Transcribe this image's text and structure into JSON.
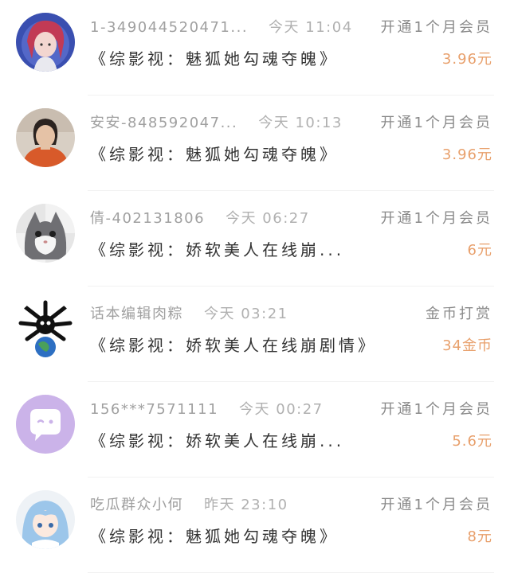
{
  "colors": {
    "amount": "#e8a06c",
    "title": "#333333",
    "meta": "#a0a0a0",
    "divider": "#f1f1f1"
  },
  "records": [
    {
      "name": "1-3490445204​71...",
      "time": "今天 11:04",
      "type": "开通1个月会员",
      "title": "《综影视：魅狐她勾魂夺魄》",
      "amount": "3.96元",
      "avatar": "anime-girl-avatar"
    },
    {
      "name": "安安-848592047...",
      "time": "今天 10:13",
      "type": "开通1个月会员",
      "title": "《综影视：魅狐她勾魂夺魄》",
      "amount": "3.96元",
      "avatar": "woman-photo-avatar"
    },
    {
      "name": "倩-402131806",
      "time": "今天 06:27",
      "type": "开通1个月会员",
      "title": "《综影视：娇软美人在线崩...",
      "amount": "6元",
      "avatar": "cat-avatar"
    },
    {
      "name": "话本编辑肉粽",
      "time": "今天 03:21",
      "type": "金币打赏",
      "title": "《综影视：娇软美人在线崩剧情》",
      "amount": "34金币",
      "avatar": "skull-earth-avatar"
    },
    {
      "name": "156***7571111",
      "time": "今天 00:27",
      "type": "开通1个月会员",
      "title": "《综影视：娇软美人在线崩...",
      "amount": "5.6元",
      "avatar": "chat-bubble-avatar"
    },
    {
      "name": "吃瓜群众小何",
      "time": "昨天 23:10",
      "type": "开通1个月会员",
      "title": "《综影视：魅狐她勾魂夺魄》",
      "amount": "8元",
      "avatar": "anime-blue-hair-avatar"
    }
  ]
}
